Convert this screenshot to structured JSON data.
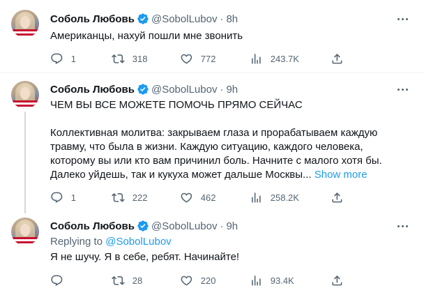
{
  "tweets": [
    {
      "name": "Соболь Любовь",
      "handle": "@SobolLubov",
      "dot": "·",
      "time": "8h",
      "text": "Американцы, нахуй пошли мне звонить",
      "replies": "1",
      "retweets": "318",
      "likes": "772",
      "views": "243.7K"
    },
    {
      "name": "Соболь Любовь",
      "handle": "@SobolLubov",
      "dot": "·",
      "time": "9h",
      "text": "ЧЕМ ВЫ ВСЕ МОЖЕТЕ ПОМОЧЬ ПРЯМО СЕЙЧАС\n\nКоллективная молитва: закрываем глаза и прорабатываем каждую травму, что была в жизни. Каждую ситуацию, каждого человека, которому вы или кто вам причинил боль. Начните с малого хотя бы. Далеко уйдешь, так и кукуха может дальше Москвы...",
      "show_more": "Show more",
      "replies": "1",
      "retweets": "222",
      "likes": "462",
      "views": "258.2K"
    },
    {
      "name": "Соболь Любовь",
      "handle": "@SobolLubov",
      "dot": "·",
      "time": "9h",
      "replying_label": "Replying to",
      "replying_handle": "@SobolLubov",
      "text": "Я не шучу. Я в себе, ребят. Начинайте!",
      "replies": "",
      "retweets": "28",
      "likes": "220",
      "views": "93.4K"
    }
  ],
  "colors": {
    "accent": "#1d9bf0",
    "secondary_text": "#536471",
    "primary_text": "#0f1419",
    "divider": "#eff3f4"
  },
  "icons": [
    "verified-badge-icon",
    "more-icon",
    "reply-icon",
    "retweet-icon",
    "like-icon",
    "views-icon",
    "share-icon"
  ]
}
